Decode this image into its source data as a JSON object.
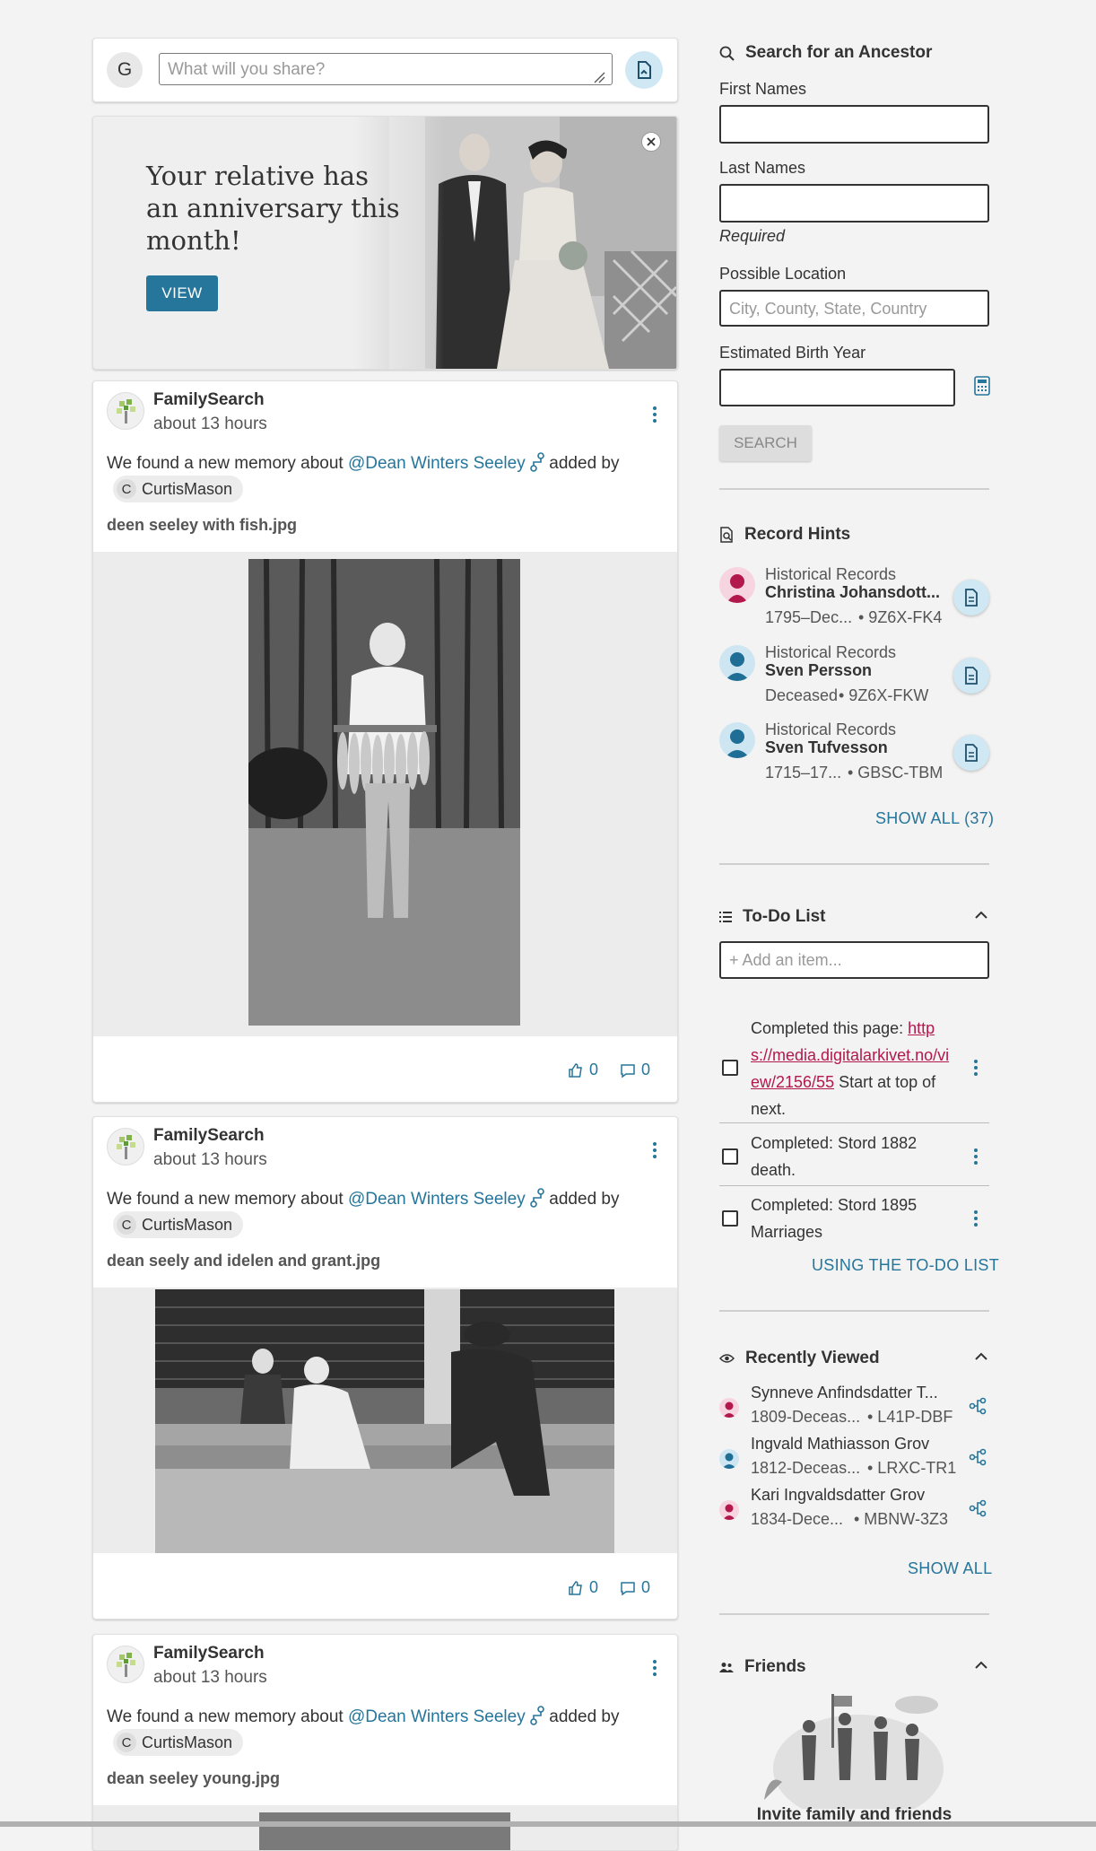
{
  "composer": {
    "avatar_letter": "G",
    "placeholder": "What will you share?"
  },
  "banner": {
    "title": "Your relative has an anniversary this month!",
    "button": "VIEW"
  },
  "posts": [
    {
      "author": "FamilySearch",
      "time": "about 13 hours",
      "text_before": "We found a new memory about",
      "person": "@Dean Winters Seeley",
      "text_after": "added by",
      "user_initial": "C",
      "user": "CurtisMason",
      "filename": "deen seeley with fish.jpg",
      "likes": "0",
      "comments": "0"
    },
    {
      "author": "FamilySearch",
      "time": "about 13 hours",
      "text_before": "We found a new memory about",
      "person": "@Dean Winters Seeley",
      "text_after": "added by",
      "user_initial": "C",
      "user": "CurtisMason",
      "filename": "dean seely and idelen and grant.jpg",
      "likes": "0",
      "comments": "0"
    },
    {
      "author": "FamilySearch",
      "time": "about 13 hours",
      "text_before": "We found a new memory about",
      "person": "@Dean Winters Seeley",
      "text_after": "added by",
      "user_initial": "C",
      "user": "CurtisMason",
      "filename": "dean seeley young.jpg"
    }
  ],
  "search": {
    "title": "Search for an Ancestor",
    "first_names_label": "First Names",
    "last_names_label": "Last Names",
    "required_note": "Required",
    "location_label": "Possible Location",
    "location_placeholder": "City, County, State, Country",
    "birth_year_label": "Estimated Birth Year",
    "button": "SEARCH"
  },
  "record_hints": {
    "title": "Record Hints",
    "items": [
      {
        "type": "Historical Records",
        "name": "Christina Johansdott...",
        "dates": "1795–Dec...",
        "pid": "• 9Z6X-FK4",
        "gender": "female"
      },
      {
        "type": "Historical Records",
        "name": "Sven Persson",
        "dates": "Deceased",
        "pid": "• 9Z6X-FKW",
        "gender": "male"
      },
      {
        "type": "Historical Records",
        "name": "Sven Tufvesson",
        "dates": "1715–17...",
        "pid": "• GBSC-TBM",
        "gender": "male"
      }
    ],
    "show_all": "SHOW ALL (37)"
  },
  "todo": {
    "title": "To-Do List",
    "add_placeholder": "+ Add an item...",
    "items": [
      {
        "prefix": "Completed this page: ",
        "link": "https://media.digitalarkivet.no/view/2156/55",
        "link_line1": "http",
        "link_line2": "s://media.digitalarkivet.no/vi",
        "link_line3": "ew/2156/55",
        "suffix_line3": " Start at top of",
        "suffix_line4": "next."
      },
      {
        "line1": "Completed: Stord 1882",
        "line2": "death."
      },
      {
        "line1": "Completed: Stord 1895",
        "line2": "Marriages"
      }
    ],
    "using_link": "USING THE TO-DO LIST"
  },
  "recently_viewed": {
    "title": "Recently Viewed",
    "items": [
      {
        "name": "Synneve Anfindsdatter T...",
        "dates": "1809-Deceas...",
        "pid": "• L41P-DBF",
        "gender": "female"
      },
      {
        "name": "Ingvald Mathiasson Grov",
        "dates": "1812-Deceas...",
        "pid": "• LRXC-TR1",
        "gender": "male"
      },
      {
        "name": "Kari Ingvaldsdatter Grov",
        "dates": "1834-Dece...",
        "pid": "• MBNW-3Z3",
        "gender": "female"
      }
    ],
    "show_all": "SHOW ALL"
  },
  "friends": {
    "title": "Friends",
    "invite": "Invite family and friends"
  },
  "colors": {
    "accent": "#26759b",
    "female": "#b3184d",
    "male": "#1e6e96",
    "hint_button_bg": "#cfe8f3"
  }
}
